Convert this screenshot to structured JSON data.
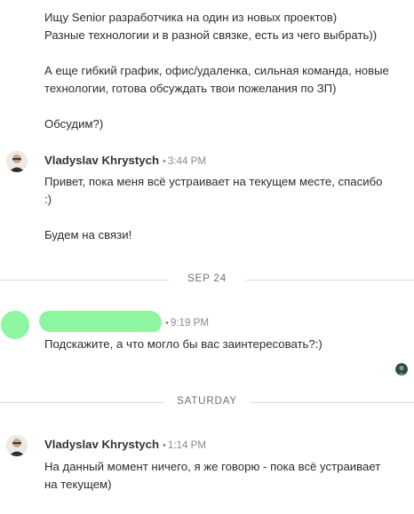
{
  "intro_message": {
    "lines": [
      "Ищу Senior разработчика на один из новых проектов)",
      "Разные технологии и в разной связке, есть из чего выбрать))",
      "",
      "А еще гибкий график, офис/удаленка, сильная команда, новые",
      "технологии, готова обсуждать твои пожелания по ЗП)",
      "",
      "Обсудим?)"
    ]
  },
  "messages": [
    {
      "sender": "Vladyslav Khrystych",
      "separator": "•",
      "time": "3:44 PM",
      "lines": [
        "Привет, пока меня всё устраивает на текущем месте, спасибо",
        ":)",
        "",
        "Будем на связи!"
      ]
    },
    {
      "sender": "",
      "separator": "•",
      "time": "9:19 PM",
      "lines": [
        "Подскажите, а что могло бы вас заинтересовать?:)"
      ]
    },
    {
      "sender": "Vladyslav Khrystych",
      "separator": "•",
      "time": "1:14 PM",
      "lines": [
        "На данный момент ничего, я же говорю - пока всё устраивает",
        "на текущем)"
      ]
    }
  ],
  "dividers": {
    "first": "SEP 24",
    "second": "SATURDAY"
  },
  "colors": {
    "redaction": "#8ef5a1",
    "divider_line": "#dcdcdc",
    "meta_text": "#8a8a8a"
  },
  "icons": {
    "avatar": "person-avatar-icon",
    "seen": "seen-receipt-icon"
  }
}
